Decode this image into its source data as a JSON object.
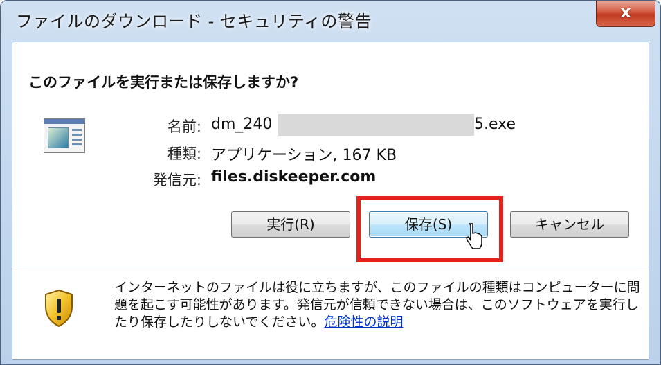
{
  "window": {
    "title": "ファイルのダウンロード - セキュリティの警告",
    "close_glyph": "x"
  },
  "dialog": {
    "question": "このファイルを実行または保存しますか?",
    "file_icon": "application-window-icon",
    "name_label": "名前:",
    "name_prefix": "dm_240",
    "name_suffix": "5.exe",
    "type_label": "種類:",
    "type_value": "アプリケーション, 167 KB",
    "from_label": "発信元:",
    "from_value": "files.diskeeper.com"
  },
  "buttons": {
    "run": "実行(R)",
    "save": "保存(S)",
    "cancel": "キャンセル"
  },
  "warning": {
    "icon": "shield-warning-icon",
    "text": "インターネットのファイルは役に立ちますが、このファイルの種類はコンピューターに問題を起こす可能性があります。発信元が信頼できない場合は、このソフトウェアを実行したり保存したりしないでください。",
    "link": "危険性の説明"
  },
  "colors": {
    "highlight": "#e4221b",
    "link": "#0033cc",
    "close_button": "#c13b22"
  }
}
